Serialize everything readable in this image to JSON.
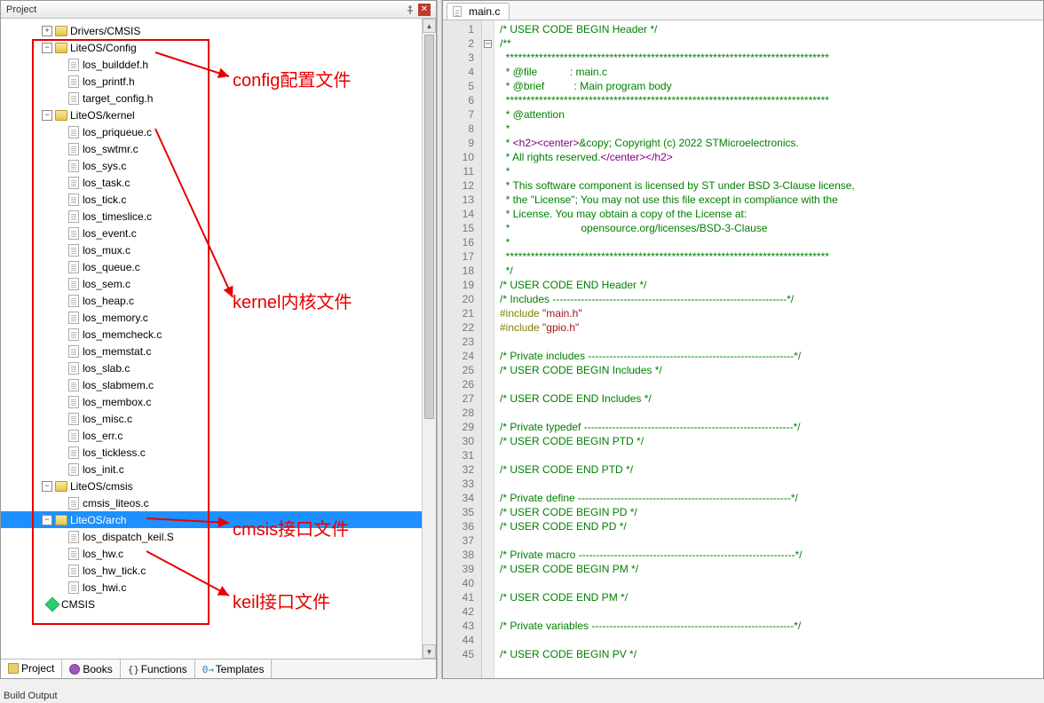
{
  "panel": {
    "title": "Project"
  },
  "tree": {
    "driversCMSIS": "Drivers/CMSIS",
    "liteosConfig": "LiteOS/Config",
    "los_builddef": "los_builddef.h",
    "los_printf": "los_printf.h",
    "target_config": "target_config.h",
    "liteosKernel": "LiteOS/kernel",
    "los_priqueue": "los_priqueue.c",
    "los_swtmr": "los_swtmr.c",
    "los_sys": "los_sys.c",
    "los_task": "los_task.c",
    "los_tick": "los_tick.c",
    "los_timeslice": "los_timeslice.c",
    "los_event": "los_event.c",
    "los_mux": "los_mux.c",
    "los_queue": "los_queue.c",
    "los_sem": "los_sem.c",
    "los_heap": "los_heap.c",
    "los_memory": "los_memory.c",
    "los_memcheck": "los_memcheck.c",
    "los_memstat": "los_memstat.c",
    "los_slab": "los_slab.c",
    "los_slabmem": "los_slabmem.c",
    "los_membox": "los_membox.c",
    "los_misc": "los_misc.c",
    "los_err": "los_err.c",
    "los_tickless": "los_tickless.c",
    "los_init": "los_init.c",
    "liteosCmsis": "LiteOS/cmsis",
    "cmsis_liteos": "cmsis_liteos.c",
    "liteosArch": "LiteOS/arch",
    "los_dispatch_keil": "los_dispatch_keil.S",
    "los_hw": "los_hw.c",
    "los_hw_tick": "los_hw_tick.c",
    "los_hwi": "los_hwi.c",
    "cmsis": "CMSIS"
  },
  "bottomTabs": {
    "project": "Project",
    "books": "Books",
    "functions": "Functions",
    "templates": "Templates"
  },
  "editor": {
    "tabName": "main.c"
  },
  "code": {
    "l1": "/* USER CODE BEGIN Header */",
    "l2": "/**",
    "l3": "  ******************************************************************************",
    "l4a": "  * @file",
    "l4b": "           : main.c",
    "l5a": "  * @brief",
    "l5b": "          : Main program body",
    "l6": "  ******************************************************************************",
    "l7": "  * @attention",
    "l8": "  *",
    "l9a": "  * ",
    "l9b": "<h2><center>",
    "l9c": "&copy; Copyright (c) 2022 STMicroelectronics.",
    "l10a": "  * All rights reserved.",
    "l10b": "</center></h2>",
    "l11": "  *",
    "l12": "  * This software component is licensed by ST under BSD 3-Clause license,",
    "l13": "  * the \"License\"; You may not use this file except in compliance with the",
    "l14": "  * License. You may obtain a copy of the License at:",
    "l15": "  *                        opensource.org/licenses/BSD-3-Clause",
    "l16": "  *",
    "l17": "  ******************************************************************************",
    "l18": "  */",
    "l19": "/* USER CODE END Header */",
    "l20": "/* Includes ------------------------------------------------------------------*/",
    "l21a": "#include ",
    "l21b": "\"main.h\"",
    "l22a": "#include ",
    "l22b": "\"gpio.h\"",
    "l24": "/* Private includes ----------------------------------------------------------*/",
    "l25": "/* USER CODE BEGIN Includes */",
    "l27": "/* USER CODE END Includes */",
    "l29": "/* Private typedef -----------------------------------------------------------*/",
    "l30": "/* USER CODE BEGIN PTD */",
    "l32": "/* USER CODE END PTD */",
    "l34": "/* Private define ------------------------------------------------------------*/",
    "l35": "/* USER CODE BEGIN PD */",
    "l36": "/* USER CODE END PD */",
    "l38": "/* Private macro -------------------------------------------------------------*/",
    "l39": "/* USER CODE BEGIN PM */",
    "l41": "/* USER CODE END PM */",
    "l43": "/* Private variables ---------------------------------------------------------*/",
    "l45": "/* USER CODE BEGIN PV */"
  },
  "annotations": {
    "config": "config配置文件",
    "kernel": "kernel内核文件",
    "cmsis": "cmsis接口文件",
    "keil": "keil接口文件"
  },
  "buildOutput": "Build Output"
}
